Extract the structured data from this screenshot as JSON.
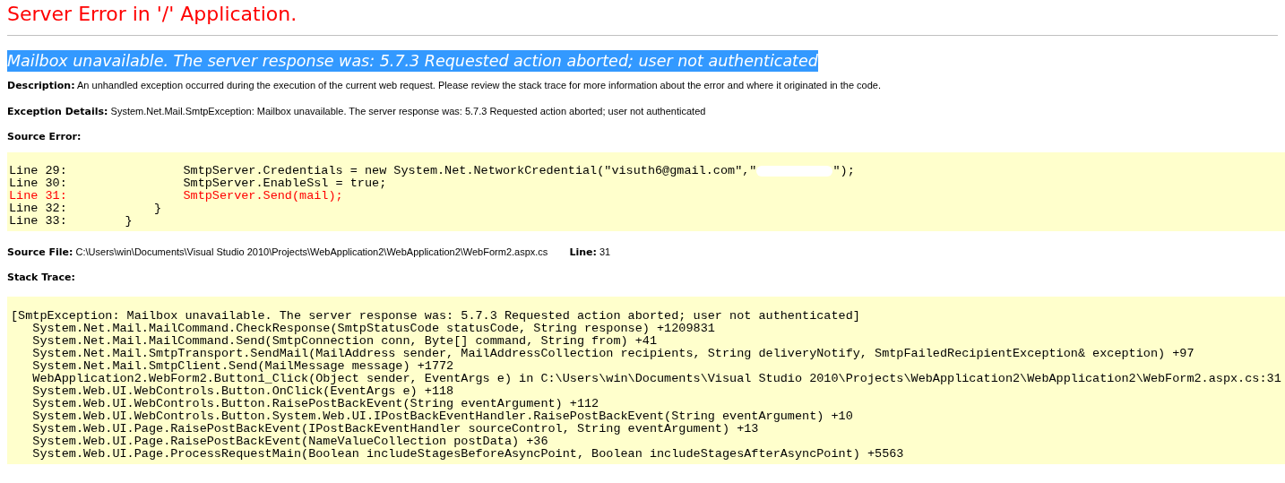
{
  "page_title": "Server Error in '/' Application.",
  "error_heading": {
    "text": "Mailbox unavailable. The server response was: 5.7.3 Requested action aborted; user not authenticated",
    "selected": true
  },
  "description": {
    "label": "Description:",
    "text": "An unhandled exception occurred during the execution of the current web request. Please review the stack trace for more information about the error and where it originated in the code."
  },
  "exception_details": {
    "label": "Exception Details:",
    "text": "System.Net.Mail.SmtpException: Mailbox unavailable. The server response was: 5.7.3 Requested action aborted; user not authenticated"
  },
  "source_error": {
    "label": "Source Error:",
    "lines": [
      {
        "line": "Line 29:",
        "code": "            SmtpServer.Credentials = new System.Net.NetworkCredential(\"visuth6@gmail.com\",\"",
        "redacted": true,
        "code_after": "\");",
        "selected": false
      },
      {
        "line": "Line 30:",
        "code": "            SmtpServer.EnableSsl = true;",
        "redacted": false,
        "selected": false
      },
      {
        "line": "Line 31:",
        "code": "            SmtpServer.Send(mail);",
        "redacted": false,
        "selected": true
      },
      {
        "line": "Line 32:",
        "code": "        }",
        "redacted": false,
        "selected": false
      },
      {
        "line": "Line 33:",
        "code": "    }",
        "redacted": false,
        "selected": false
      }
    ]
  },
  "source_file": {
    "label": "Source File:",
    "path": "C:\\Users\\win\\Documents\\Visual Studio 2010\\Projects\\WebApplication2\\WebApplication2\\WebForm2.aspx.cs",
    "line_label": "Line:",
    "line": "31"
  },
  "stack_trace": {
    "label": "Stack Trace:",
    "lines": [
      "[SmtpException: Mailbox unavailable. The server response was: 5.7.3 Requested action aborted; user not authenticated]",
      "   System.Net.Mail.MailCommand.CheckResponse(SmtpStatusCode statusCode, String response) +1209831",
      "   System.Net.Mail.MailCommand.Send(SmtpConnection conn, Byte[] command, String from) +41",
      "   System.Net.Mail.SmtpTransport.SendMail(MailAddress sender, MailAddressCollection recipients, String deliveryNotify, SmtpFailedRecipientException& exception) +97",
      "   System.Net.Mail.SmtpClient.Send(MailMessage message) +1772",
      "   WebApplication2.WebForm2.Button1_Click(Object sender, EventArgs e) in C:\\Users\\win\\Documents\\Visual Studio 2010\\Projects\\WebApplication2\\WebApplication2\\WebForm2.aspx.cs:31",
      "   System.Web.UI.WebControls.Button.OnClick(EventArgs e) +118",
      "   System.Web.UI.WebControls.Button.RaisePostBackEvent(String eventArgument) +112",
      "   System.Web.UI.WebControls.Button.System.Web.UI.IPostBackEventHandler.RaisePostBackEvent(String eventArgument) +10",
      "   System.Web.UI.Page.RaisePostBackEvent(IPostBackEventHandler sourceControl, String eventArgument) +13",
      "   System.Web.UI.Page.RaisePostBackEvent(NameValueCollection postData) +36",
      "   System.Web.UI.Page.ProcessRequestMain(Boolean includeStagesBeforeAsyncPoint, Boolean includeStagesAfterAsyncPoint) +5563"
    ]
  }
}
